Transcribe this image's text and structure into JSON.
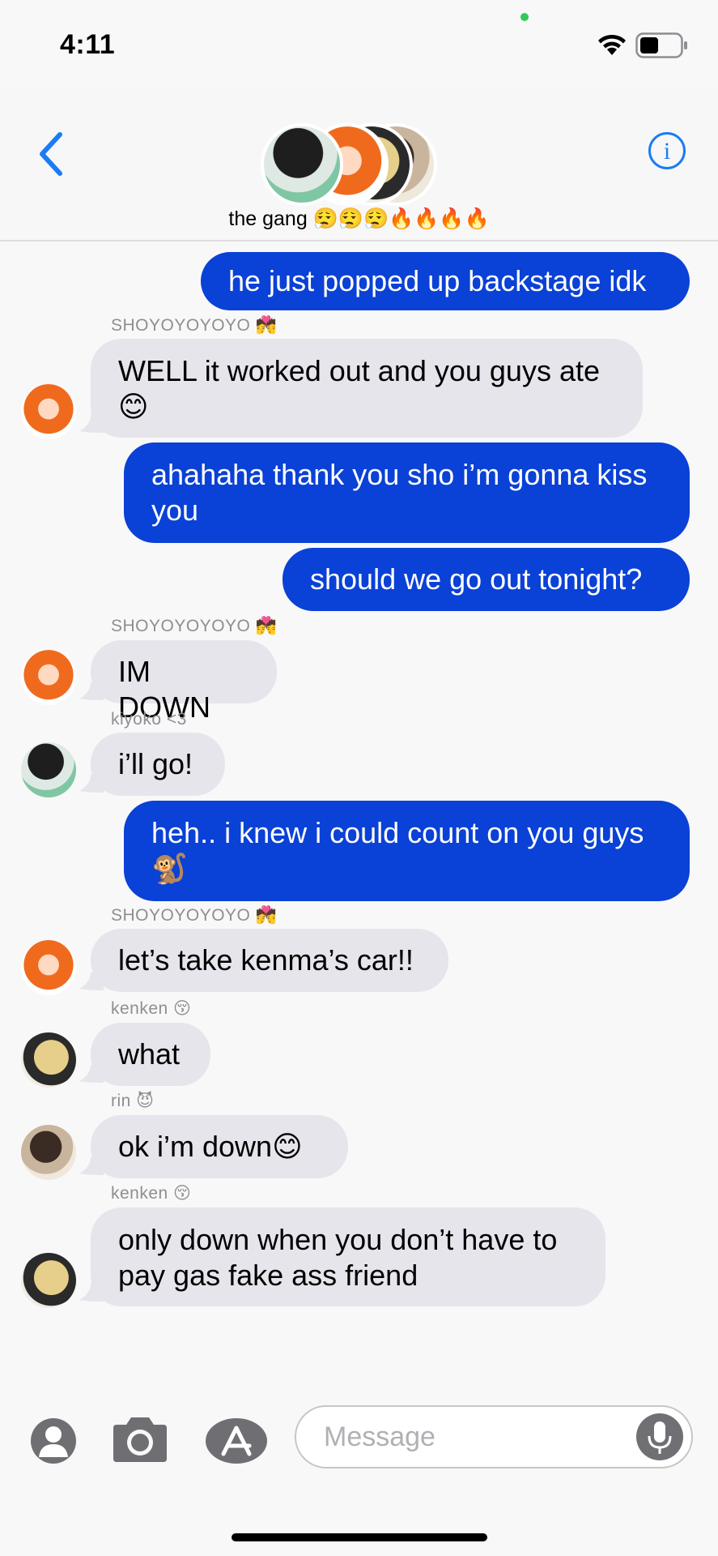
{
  "status_bar": {
    "time": "4:11"
  },
  "header": {
    "title": "the gang 😮‍💨😮‍💨😮‍💨🔥🔥🔥🔥"
  },
  "messages": [
    {
      "dir": "out",
      "text": "he just popped up backstage idk"
    },
    {
      "dir": "in",
      "sender": "SHOYOYOYOYO 💏",
      "avatar": "shoyo",
      "text": "WELL it worked out and you guys ate 😊"
    },
    {
      "dir": "out",
      "text": "ahahaha thank you sho i’m gonna kiss you"
    },
    {
      "dir": "out",
      "text": "should we go out tonight?"
    },
    {
      "dir": "in",
      "sender": "SHOYOYOYOYO 💏",
      "avatar": "shoyo",
      "text": "IM DOWN"
    },
    {
      "dir": "in",
      "sender": "kiyoko <3",
      "avatar": "kiyoko",
      "text": "i’ll go!"
    },
    {
      "dir": "out",
      "text": "heh.. i knew i could count on you guys 🐒"
    },
    {
      "dir": "in",
      "sender": "SHOYOYOYOYO 💏",
      "avatar": "shoyo",
      "text": "let’s take kenma’s car!!"
    },
    {
      "dir": "in",
      "sender": "kenken 😚",
      "avatar": "kenken",
      "text": "what"
    },
    {
      "dir": "in",
      "sender": "rin 😈",
      "avatar": "rin",
      "text": "ok i’m down😊"
    },
    {
      "dir": "in",
      "sender": "kenken 😚",
      "avatar": "kenken",
      "text": "only down when you don’t have to pay gas fake ass friend"
    }
  ],
  "composer": {
    "placeholder": "Message"
  },
  "icons": [
    "back-chevron-icon",
    "info-icon",
    "contact-icon",
    "camera-icon",
    "app-store-icon",
    "microphone-icon",
    "wifi-icon",
    "battery-icon"
  ],
  "colors": {
    "outgoing_bubble": "#0a41d6",
    "incoming_bubble": "#e6e5eb",
    "accent": "#1a7cf5"
  }
}
